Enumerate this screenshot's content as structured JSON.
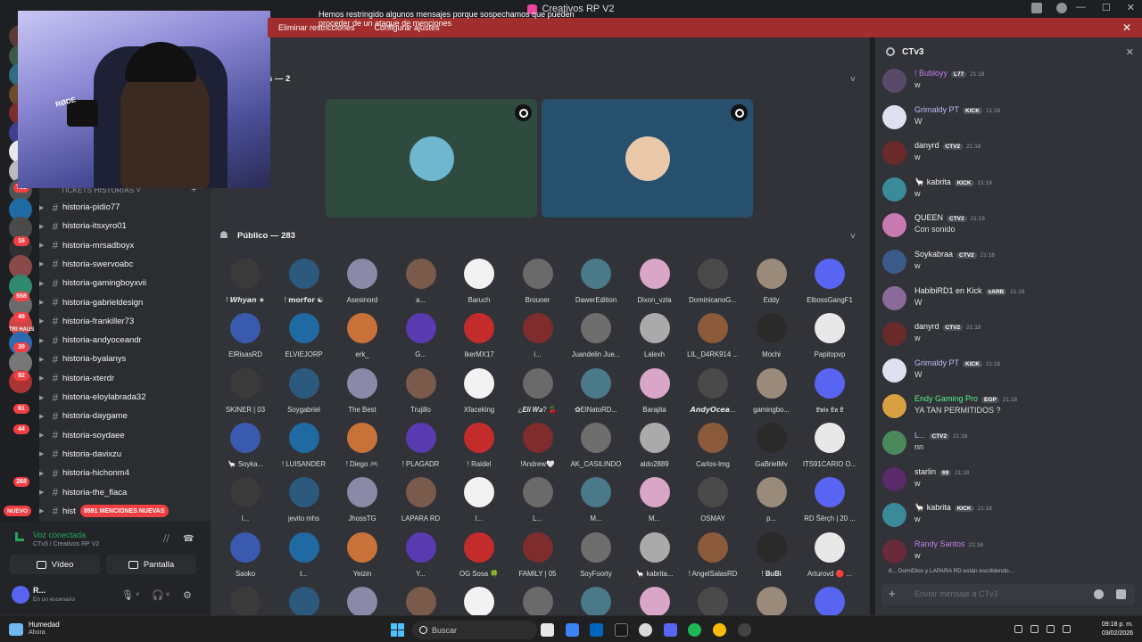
{
  "window": {
    "title": "Creativos RP V2",
    "controls": [
      "—",
      "☐",
      "✕"
    ]
  },
  "banner": {
    "message": "Hemos restringido algunos mensajes porque sospechamos que pueden proceder de un ataque de menciones",
    "action1": "Eliminar restricciones",
    "action2": "Configurar ajustes",
    "close": "✕"
  },
  "servers": {
    "badges": [
      "768",
      "16",
      "558",
      "48",
      "39",
      "82",
      "61",
      "44",
      "268"
    ],
    "new_label": "NUEVO",
    "mentions_pill": "8591 MENCIONES NUEVAS",
    "labels": [
      "TRI HAUS"
    ]
  },
  "sidebar": {
    "category": "TICKETS HISTORIAS",
    "channels": [
      "historia-pidio77",
      "historia-itsxyro01",
      "historia-mrsadboyx",
      "historia-swervoabc",
      "historia-gamingboyxvii",
      "historia-gabrieldesign",
      "historia-frankiller73",
      "historia-andyoceandr",
      "historia-byalanys",
      "historia-xterdr",
      "historia-eloylabrada32",
      "historia-daygame",
      "historia-soydaee",
      "historia-davixzu",
      "historia-hichonm4",
      "historia-the_flaca",
      "hist"
    ]
  },
  "voice": {
    "status": "Voz conectada",
    "location": "CTv3 / Creativos RP V2",
    "video_label": "Vídeo",
    "screen_label": "Pantalla"
  },
  "user": {
    "name": "R...",
    "status": "En un escenario"
  },
  "webcam": {
    "mic_brand": "RØDE"
  },
  "stage": {
    "speakers_header": "s — 2",
    "audience_header": "Público — 283",
    "tile_colors": [
      "#2f4a3f",
      "#27506f"
    ]
  },
  "audience": [
    "! 𝙒𝙝𝙮𝙖𝙣 ★",
    "! 𝗺𝗼𝗿𝗳𝗼𝗿 ☯",
    "Asesinord",
    "a...",
    "Baruch",
    "Brouner",
    "DawerEdition",
    "Dixon_vzla",
    "DominicanoG...",
    "Eddy",
    "ElbossGangF1",
    "ElRisasRD",
    "ELVIEJORP",
    "erk_",
    "G...",
    "IkerMX17",
    "i...",
    "Juandelin Jue...",
    "Lalexh",
    "LIL_D4RK914 ...",
    "Mochi",
    "Papitopvp",
    "SKINER | 03",
    "Soygabriel",
    "The Best",
    "Trujillo",
    "Xfaceking",
    "¿𝑬𝒍𝒊 𝑾𝒂? 🍒",
    "✿ElNatoRD...",
    "Barajita",
    "𝘼𝙣𝙙𝙮𝙊𝙘𝙚𝙖...",
    "gamingbo...",
    "𝕷𝖚𝖎𝖘 𝕷𝖆 𝕷",
    "🦙 Soyka...",
    "! LUISANDER",
    "! Diego 🎮",
    "! PLAGADR",
    "! Raidel",
    "!Andrew🤍",
    "AK_CASILINDO",
    "aldo2889",
    "Carlos-lmg",
    "GaBrielMv",
    "ITS91CARIO O...",
    "l...",
    "jevito mhs",
    "JhossTG",
    "LAPARA RD",
    "l...",
    "L...",
    "M...",
    "M...",
    "OSMAY",
    "p...",
    "RD Ŝêrçh | 20 ...",
    "Saoko",
    "t...",
    "Yeizin",
    "Y...",
    "OG Sosa 🍀",
    "FAMILY | 05",
    "SoyFoorty",
    "🦙 kabrita...",
    "! AngelSalasRD",
    "! 𝐁𝐮𝐁𝐢",
    "Arturovd 🔴 ...",
    "",
    "",
    "",
    "",
    "",
    "",
    "",
    "",
    "",
    "",
    ""
  ],
  "chat": {
    "channel": "CTv3",
    "close": "✕",
    "messages": [
      {
        "name": "Bubloyy",
        "prefix": "!",
        "tags": [
          "L77"
        ],
        "time": "21:18",
        "text": "w",
        "color": "#c27cf2"
      },
      {
        "name": "Grimaldy PT",
        "tags": [
          "KICK"
        ],
        "time": "21:18",
        "text": "W",
        "color": "#b9bbff"
      },
      {
        "name": "danyrd",
        "tags": [
          "CTV2"
        ],
        "time": "21:18",
        "text": "w",
        "color": "#f2f3f5"
      },
      {
        "name": "🦙 kabrita",
        "tags": [
          "KICK"
        ],
        "time": "21:18",
        "text": "w",
        "color": "#f2f3f5"
      },
      {
        "name": "QUEEN",
        "tags": [
          "CTV2"
        ],
        "time": "21:18",
        "text": "Con sonido",
        "color": "#f2f3f5"
      },
      {
        "name": "Soykabraa",
        "tags": [
          "CTV2"
        ],
        "time": "21:18",
        "text": "w",
        "color": "#f2f3f5"
      },
      {
        "name": "HabibiRD1 en Kick",
        "tags": [
          "xARB"
        ],
        "time": "21:18",
        "text": "W",
        "color": "#f2f3f5"
      },
      {
        "name": "danyrd",
        "tags": [
          "CTV2"
        ],
        "time": "21:18",
        "text": "w",
        "color": "#f2f3f5"
      },
      {
        "name": "Grimaldy PT",
        "tags": [
          "KICK"
        ],
        "time": "21:18",
        "text": "W",
        "color": "#b9bbff"
      },
      {
        "name": "Endy Gaming Pro",
        "tags": [
          "EGP"
        ],
        "time": "21:18",
        "text": "YA TAN PERMITIDOS ?",
        "color": "#57f287"
      },
      {
        "name": "L...",
        "tags": [
          "CTV2"
        ],
        "time": "21:18",
        "text": "nn",
        "color": "#b9bbff"
      },
      {
        "name": "starlin",
        "tags": [
          "69"
        ],
        "time": "21:18",
        "text": "w",
        "color": "#f2f3f5"
      },
      {
        "name": "🦙 kabrita",
        "tags": [
          "KICK"
        ],
        "time": "21:18",
        "text": "w",
        "color": "#f2f3f5"
      },
      {
        "name": "Randy Santos",
        "tags": [],
        "time": "21:18",
        "text": "w",
        "color": "#c27cf2"
      }
    ],
    "typing": "8... DomiDios y LAPARA RD están escribiendo...",
    "input_placeholder": "Enviar mensaje a CTv3"
  },
  "taskbar": {
    "weather_title": "Humedad",
    "weather_sub": "Ahora",
    "search": "Buscar",
    "time": "09:18 p. m.",
    "date": "03/02/2026"
  },
  "colors": {
    "accent": "#5865f2",
    "danger": "#a12d2d",
    "online": "#23a55a"
  }
}
